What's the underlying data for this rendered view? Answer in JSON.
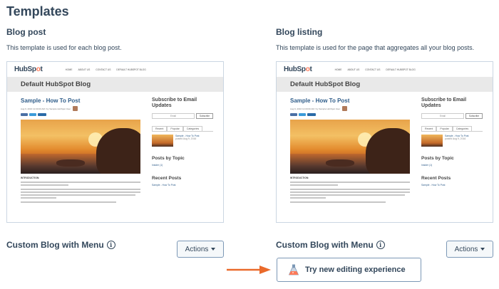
{
  "page": {
    "title": "Templates"
  },
  "templates": [
    {
      "title": "Blog post",
      "description": "This template is used for each blog post."
    },
    {
      "title": "Blog listing",
      "description": "This template is used for the page that aggregates all your blog posts."
    }
  ],
  "preview": {
    "logo": "HubSpot",
    "nav": [
      "HOME",
      "ABOUT US",
      "CONTACT US",
      "DEFAULT HUBSPOT BLOG"
    ],
    "blog_name": "Default HubSpot Blog",
    "post_title": "Sample - How To Post",
    "post_meta": "Aug 9, 2016 12:00:00 AM / by Sample HubSpot User",
    "intro_label": "INTRODUCTION:",
    "subscribe_heading": "Subscribe to Email Updates",
    "email_placeholder": "Email",
    "subscribe_button": "Subscribe",
    "side_tabs": [
      "Recent",
      "Popular",
      "Categories"
    ],
    "recent_item_title": "Sample - How To Post",
    "recent_item_date": "posted Aug 9, 2016",
    "posts_by_topic_heading": "Posts by Topic",
    "topic_item": "Insider (1)",
    "recent_posts_heading": "Recent Posts",
    "recent_posts_item": "Sample - How To Post"
  },
  "footer_rows": {
    "template_name": "Custom Blog with Menu",
    "info_icon": "info-icon",
    "actions_label": "Actions",
    "try_label": "Try new editing experience",
    "try_icon": "flask-icon"
  },
  "colors": {
    "arrow": "#ea6a2b",
    "text": "#33475b",
    "border": "#7c98b6"
  }
}
